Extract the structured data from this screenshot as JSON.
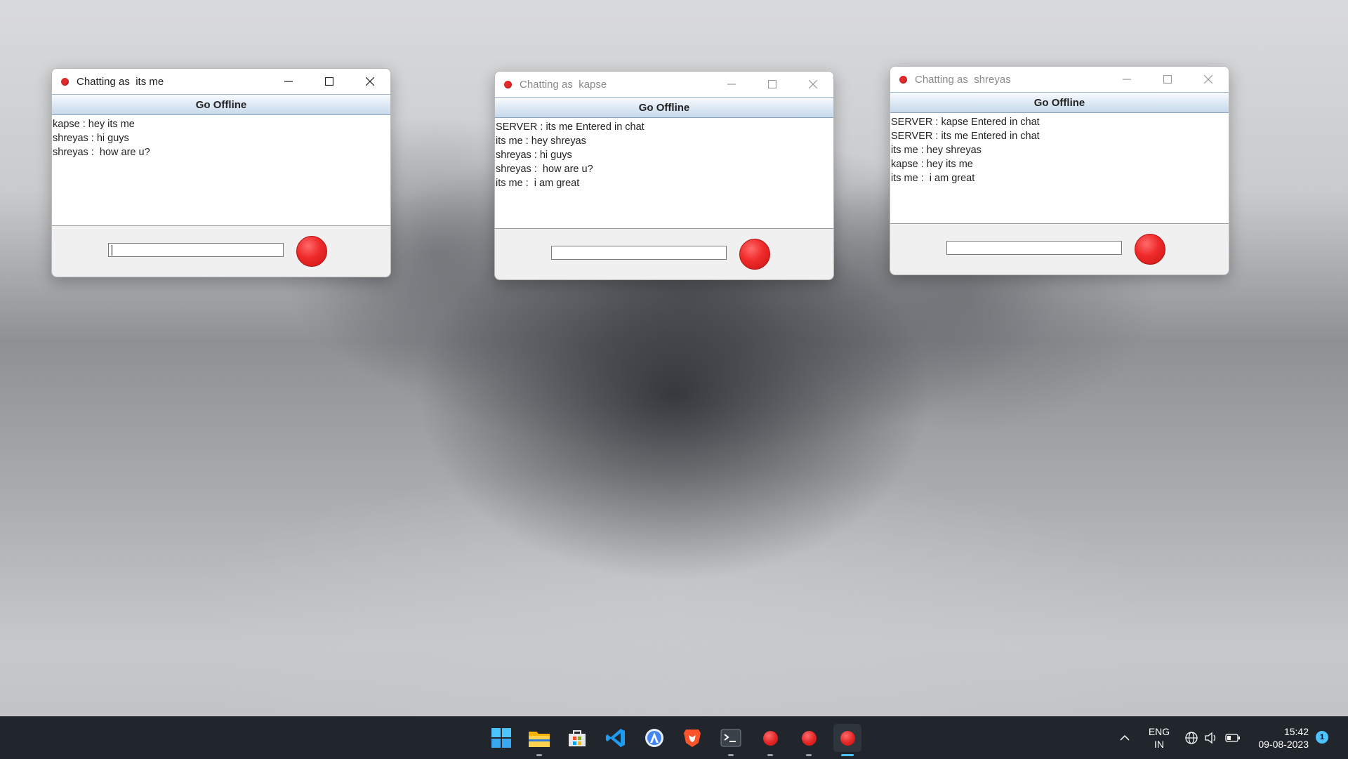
{
  "windows": [
    {
      "title": "Chatting as  its me",
      "active": true,
      "offline_label": "Go Offline",
      "messages": [
        "kapse : hey its me",
        "shreyas : hi guys",
        "shreyas :  how are u?"
      ],
      "input_value": ""
    },
    {
      "title": "Chatting as  kapse",
      "active": false,
      "offline_label": "Go Offline",
      "messages": [
        "SERVER : its me Entered in chat",
        "its me : hey shreyas",
        "shreyas : hi guys",
        "shreyas :  how are u?",
        "its me :  i am great"
      ],
      "input_value": ""
    },
    {
      "title": "Chatting as  shreyas",
      "active": false,
      "offline_label": "Go Offline",
      "messages": [
        "SERVER : kapse Entered in chat",
        "SERVER : its me Entered in chat",
        "its me : hey shreyas",
        "kapse : hey its me",
        "its me :  i am great"
      ],
      "input_value": ""
    }
  ],
  "taskbar": {
    "apps": [
      "windows-start-icon",
      "file-explorer-icon",
      "microsoft-store-icon",
      "vscode-icon",
      "android-studio-icon",
      "brave-browser-icon",
      "terminal-icon",
      "java-app-icon",
      "java-app-icon",
      "java-app-icon"
    ],
    "language": "ENG",
    "region": "IN",
    "time": "15:42",
    "date": "09-08-2023",
    "notification_count": "1"
  },
  "colors": {
    "accent": "#4cc2ff",
    "send_button": "#e42b2b",
    "taskbar": "#20262c"
  }
}
